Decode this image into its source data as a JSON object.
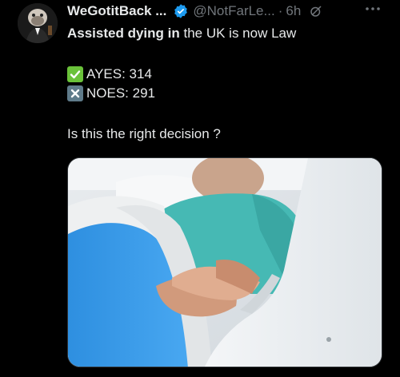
{
  "tweet": {
    "display_name": "WeGotitBack ...",
    "handle": "@NotFarLe...",
    "separator": "·",
    "time": "6h",
    "line1_bold": "Assisted dying in",
    "line1_rest": " the UK is now Law",
    "ayes": "AYES: 314",
    "noes": "NOES: 291",
    "question": "Is this the right decision ?"
  },
  "icons": {
    "verified": "verified-badge-icon",
    "edit": "edited-icon",
    "more": "more-options-icon",
    "check": "check-mark-emoji",
    "cross": "cross-mark-emoji"
  },
  "colors": {
    "background": "#000000",
    "text": "#e7e9ea",
    "muted": "#71767b",
    "verified_blue": "#1d9bf0",
    "check_green": "#6ac23a",
    "cross_grey": "#5f7b8a"
  }
}
